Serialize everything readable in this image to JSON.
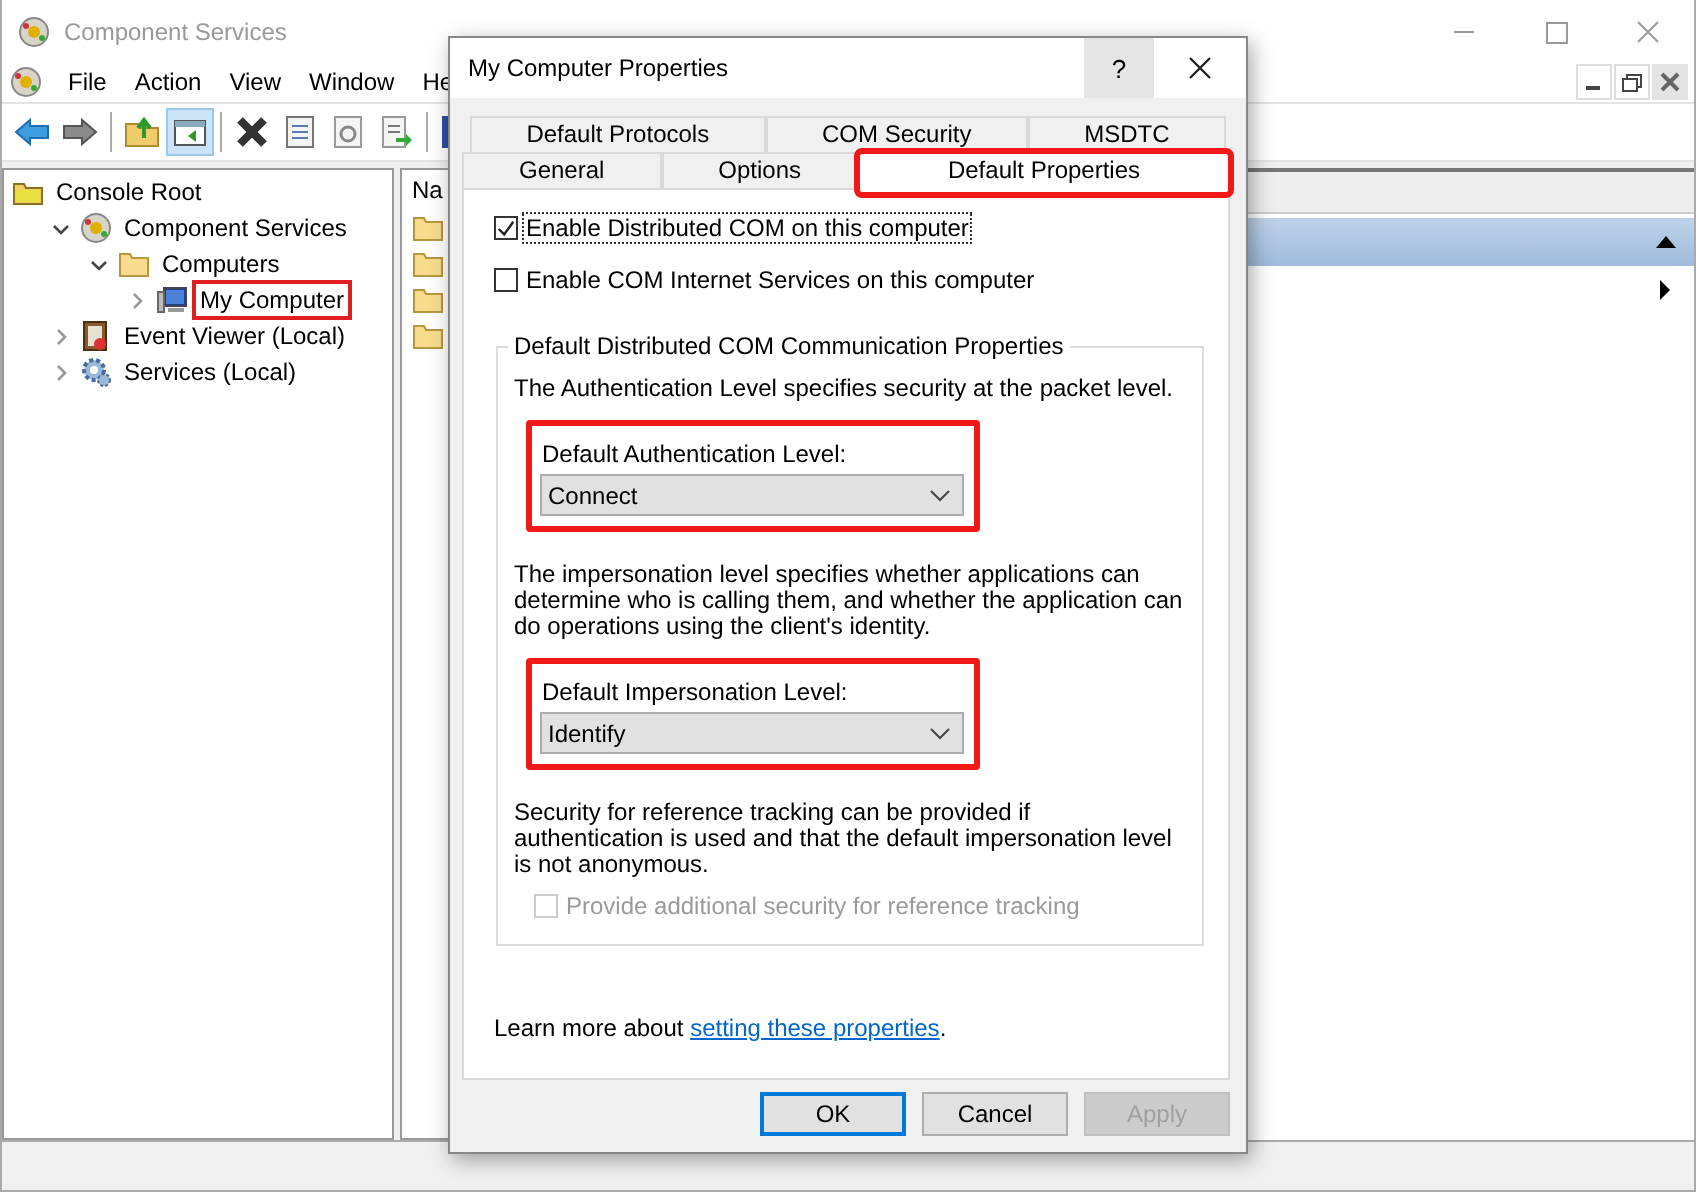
{
  "window": {
    "title": "Component Services"
  },
  "menu": [
    {
      "label": "File"
    },
    {
      "label": "Action"
    },
    {
      "label": "View"
    },
    {
      "label": "Window"
    },
    {
      "label": "He"
    }
  ],
  "toolbar": [
    {
      "kind": "back"
    },
    {
      "kind": "forward"
    },
    {
      "kind": "sep"
    },
    {
      "kind": "up"
    },
    {
      "kind": "tree-toggle",
      "pressed": true
    },
    {
      "kind": "sep"
    },
    {
      "kind": "delete"
    },
    {
      "kind": "properties"
    },
    {
      "kind": "refresh"
    },
    {
      "kind": "export"
    },
    {
      "kind": "sep"
    },
    {
      "kind": "help"
    }
  ],
  "tree": {
    "label": "Console Root",
    "kind": "root",
    "children": [
      {
        "label": "Component Services",
        "kind": "component",
        "expanded": true,
        "highlighted": false,
        "children": [
          {
            "label": "Computers",
            "kind": "folder",
            "expanded": true,
            "highlighted": false,
            "children": [
              {
                "label": "My Computer",
                "kind": "computer",
                "expanded": false,
                "highlighted": true
              }
            ]
          }
        ]
      },
      {
        "label": "Event Viewer (Local)",
        "kind": "event",
        "expanded": false,
        "highlighted": false
      },
      {
        "label": "Services (Local)",
        "kind": "services",
        "expanded": false,
        "highlighted": false
      }
    ]
  },
  "middle_pane": {
    "column_1": "Na",
    "rows": [
      {
        "kind": "folder"
      },
      {
        "kind": "folder"
      },
      {
        "kind": "folder"
      },
      {
        "kind": "folder"
      }
    ]
  },
  "dialog": {
    "title": "My Computer Properties",
    "help_button": "?",
    "tab_rows": [
      [
        {
          "label": "Default Protocols",
          "selected": false,
          "highlighted": false
        },
        {
          "label": "COM Security",
          "selected": false,
          "highlighted": false
        },
        {
          "label": "MSDTC",
          "selected": false,
          "highlighted": false
        }
      ],
      [
        {
          "label": "General",
          "selected": false,
          "highlighted": false
        },
        {
          "label": "Options",
          "selected": false,
          "highlighted": false
        },
        {
          "label": "Default Properties",
          "selected": true,
          "highlighted": true
        }
      ]
    ],
    "checkboxes": [
      {
        "label": "Enable Distributed COM on this computer",
        "checked": true,
        "focused": true
      },
      {
        "label": "Enable COM Internet Services on this computer",
        "checked": false,
        "focused": false
      }
    ],
    "group": {
      "legend": "Default Distributed COM Communication Properties",
      "auth_text": "The Authentication Level specifies security at the packet level.",
      "auth": {
        "label": "Default Authentication Level:",
        "value": "Connect",
        "highlighted": true
      },
      "imp_text": "The impersonation level specifies whether applications can determine who is calling them, and whether the application can do operations using the client's identity.",
      "imp": {
        "label": "Default Impersonation Level:",
        "value": "Identify",
        "highlighted": true
      },
      "ref_text": "Security for reference tracking can be provided if authentication is used and that the default impersonation level is not anonymous.",
      "ref_checkbox": {
        "label": "Provide additional security for reference tracking",
        "checked": false,
        "disabled": true
      }
    },
    "learn_more": {
      "before": "Learn more about ",
      "link": "setting these properties",
      "after": "."
    },
    "buttons": [
      {
        "label": "OK",
        "default": true,
        "disabled": false
      },
      {
        "label": "Cancel",
        "default": false,
        "disabled": false
      },
      {
        "label": "Apply",
        "default": false,
        "disabled": true
      }
    ]
  }
}
